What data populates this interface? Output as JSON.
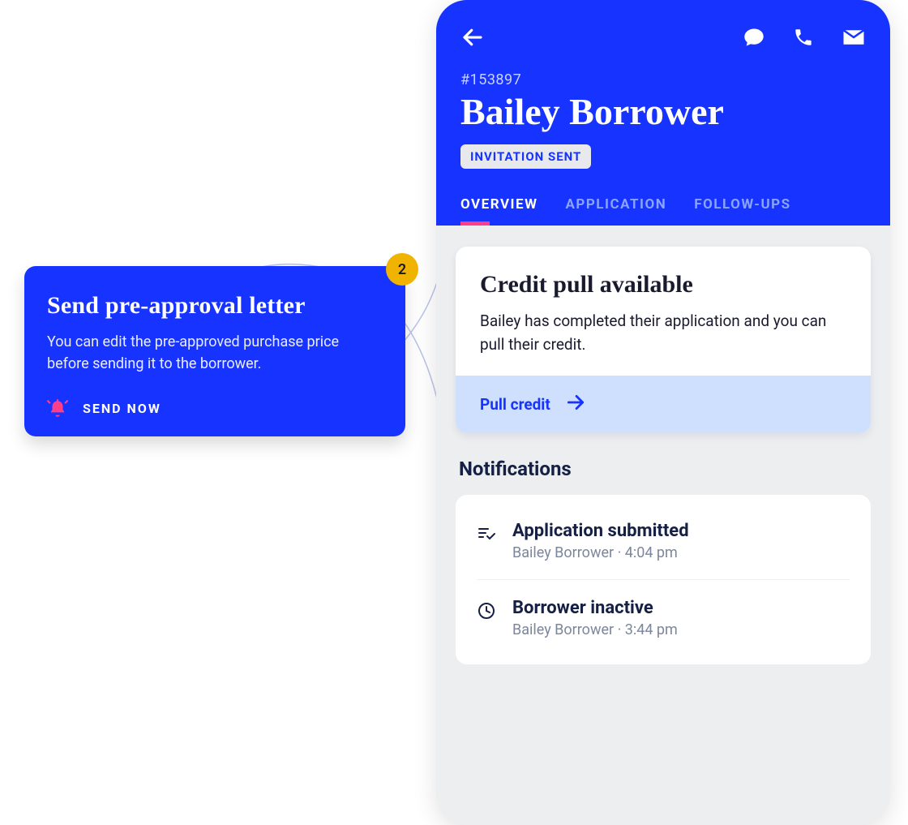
{
  "callout": {
    "badge_count": "2",
    "title": "Send pre-approval letter",
    "body": "You can edit the pre-approved purchase price before sending it to the borrower.",
    "action_label": "SEND NOW"
  },
  "phone": {
    "record_id": "#153897",
    "borrower_name": "Bailey Borrower",
    "status_label": "INVITATION SENT",
    "tabs": {
      "overview": "OVERVIEW",
      "application": "APPLICATION",
      "followups": "FOLLOW-UPS"
    },
    "credit_card": {
      "title": "Credit pull available",
      "body": "Bailey has completed their application and you can pull their credit.",
      "action_label": "Pull credit"
    },
    "notifications_heading": "Notifications",
    "notifications": [
      {
        "title": "Application submitted",
        "meta": "Bailey Borrower · 4:04 pm"
      },
      {
        "title": "Borrower inactive",
        "meta": "Bailey Borrower · 3:44 pm"
      }
    ]
  }
}
